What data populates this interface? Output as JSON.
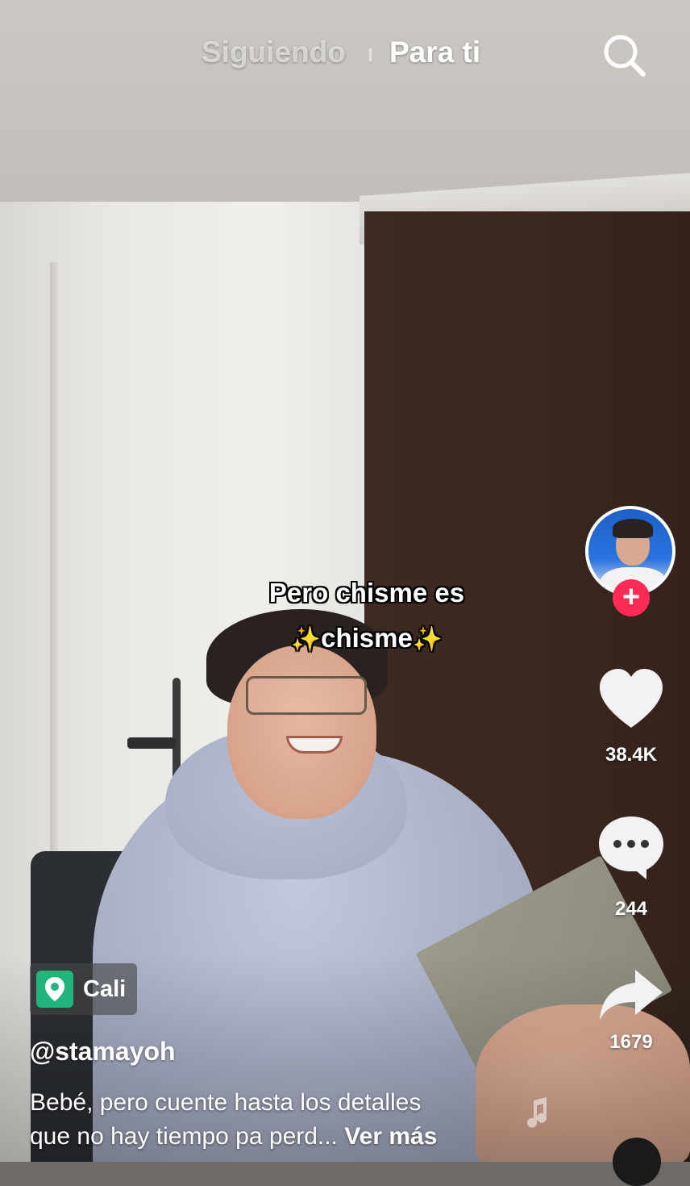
{
  "header": {
    "tab_following": "Siguiendo",
    "tab_for_you": "Para ti",
    "search_icon": "search-icon"
  },
  "video": {
    "caption_line1": "Pero chisme es",
    "caption_line2": "chisme",
    "sparkle_left": "✨",
    "sparkle_right": "✨"
  },
  "actions": {
    "avatar_icon": "avatar",
    "follow_symbol": "+",
    "like_count": "38.4K",
    "comment_count": "244",
    "share_count": "1679"
  },
  "post": {
    "location": "Cali",
    "username": "@stamayoh",
    "description_line1": "Bebé, pero cuente hasta los detalles",
    "description_line2": "que no hay tiempo pa perd...",
    "see_more": "Ver más"
  },
  "colors": {
    "follow_badge": "#fe2c55",
    "location_pin": "#21b47d",
    "text": "#ffffff"
  }
}
